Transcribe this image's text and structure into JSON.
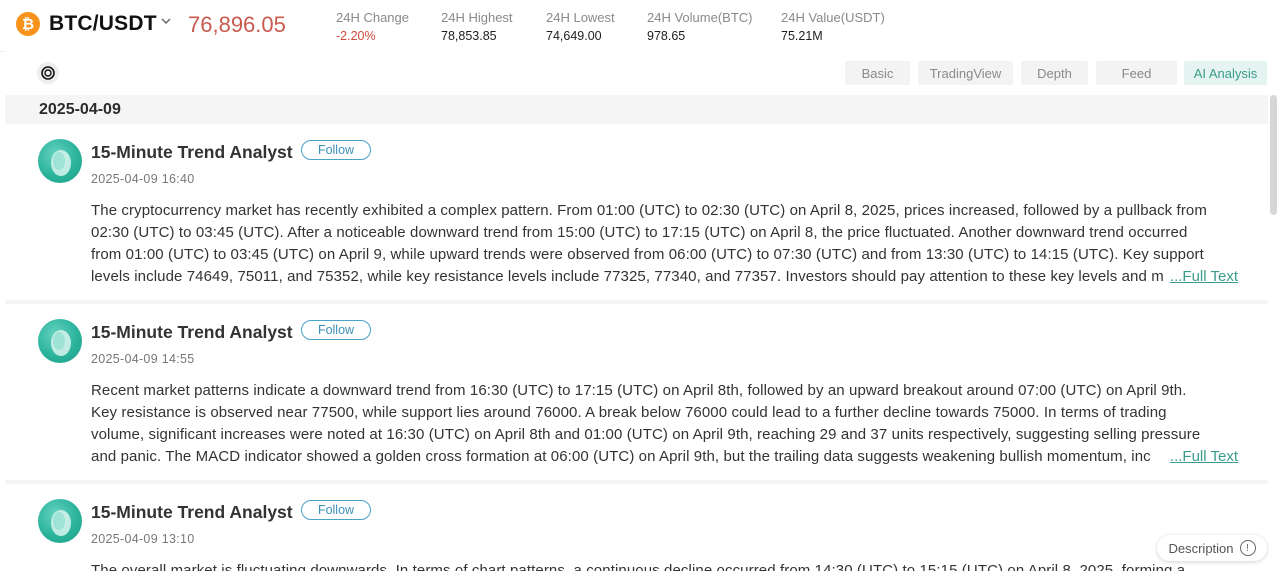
{
  "ticker": {
    "coin_symbol": "₿",
    "pair": "BTC/USDT",
    "price": "76,896.05",
    "stats": [
      {
        "label": "24H Change",
        "value": "-2.20%"
      },
      {
        "label": "24H Highest",
        "value": "78,853.85"
      },
      {
        "label": "24H Lowest",
        "value": "74,649.00"
      },
      {
        "label": "24H Volume(BTC)",
        "value": "978.65"
      },
      {
        "label": "24H Value(USDT)",
        "value": "75.21M"
      }
    ]
  },
  "tabs": [
    "Basic",
    "TradingView",
    "Depth",
    "Feed",
    "AI Analysis"
  ],
  "active_tab": "AI Analysis",
  "feed": {
    "date": "2025-04-09",
    "full_text_label": "...Full Text",
    "follow_label": "Follow",
    "posts": [
      {
        "author": "15-Minute Trend Analyst",
        "time": "2025-04-09 16:40",
        "lines": [
          "The cryptocurrency market has recently exhibited a complex pattern. From 01:00 (UTC) to 02:30 (UTC) on April 8, 2025, prices increased, followed by a pullback from",
          "02:30 (UTC) to 03:45 (UTC). After a noticeable downward trend from 15:00 (UTC) to 17:15 (UTC) on April 8, the price fluctuated. Another downward trend occurred",
          "from 01:00 (UTC) to 03:45 (UTC) on April 9, while upward trends were observed from 06:00 (UTC) to 07:30 (UTC) and from 13:30 (UTC) to 14:15 (UTC). Key support",
          "levels include 74649, 75011, and 75352, while key resistance levels include 77325, 77340, and 77357. Investors should pay attention to these key levels and m"
        ]
      },
      {
        "author": "15-Minute Trend Analyst",
        "time": "2025-04-09 14:55",
        "lines": [
          "Recent market patterns indicate a downward trend from 16:30 (UTC) to 17:15 (UTC) on April 8th, followed by an upward breakout around 07:00 (UTC) on April 9th.",
          "Key resistance is observed near 77500, while support lies around 76000. A break below 76000 could lead to a further decline towards 75000. In terms of trading",
          "volume, significant increases were noted at 16:30 (UTC) on April 8th and 01:00 (UTC) on April 9th, reaching 29 and 37 units respectively, suggesting selling pressure",
          "and panic. The MACD indicator showed a golden cross formation at 06:00 (UTC) on April 9th, but the trailing data suggests weakening bullish momentum, inc"
        ]
      },
      {
        "author": "15-Minute Trend Analyst",
        "time": "2025-04-09 13:10",
        "lines": [
          "The overall market is fluctuating downwards. In terms of chart patterns, a continuous decline occurred from 14:30 (UTC) to 15:15 (UTC) on April 8, 2025, forming a"
        ]
      }
    ]
  },
  "description_label": "Description",
  "colors": {
    "price": "#c85a4e",
    "negative": "#d24a3a",
    "accent": "#3a9c8a",
    "follow": "#3c8fb6",
    "coin": "#f7931a"
  }
}
